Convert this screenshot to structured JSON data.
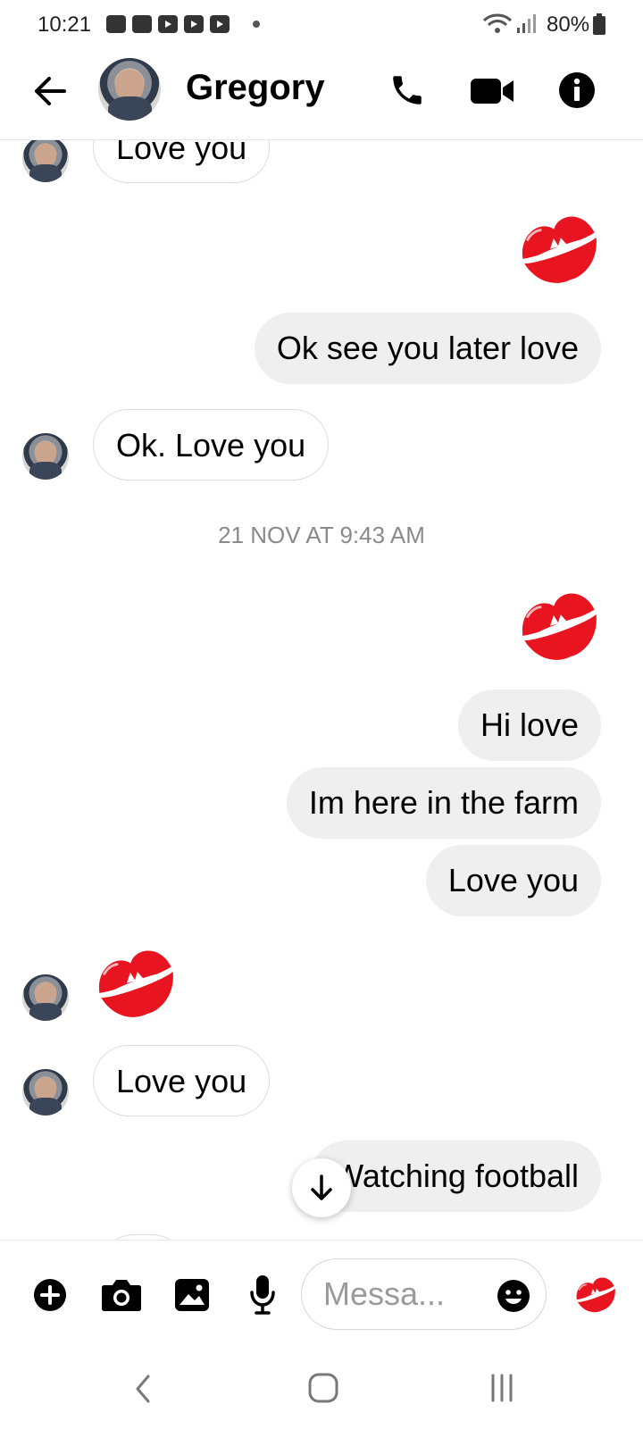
{
  "status_bar": {
    "time": "10:21",
    "battery": "80%",
    "notification_icons": [
      "shopping-bag-icon",
      "folder-icon",
      "youtube-icon",
      "youtube-icon",
      "youtube-icon"
    ]
  },
  "header": {
    "contact_name": "Gregory",
    "actions": [
      "phone-icon",
      "video-icon",
      "info-icon"
    ]
  },
  "messages": [
    {
      "from": "them",
      "text": "Love you"
    },
    {
      "from": "me",
      "emoji": "kiss-mark"
    },
    {
      "from": "me",
      "text": "Ok see you later love"
    },
    {
      "from": "them",
      "text": "Ok. Love you"
    },
    {
      "type": "timestamp",
      "text": "21 NOV AT 9:43 AM"
    },
    {
      "from": "me",
      "emoji": "kiss-mark"
    },
    {
      "from": "me",
      "text": "Hi love"
    },
    {
      "from": "me",
      "text": "Im here in the farm"
    },
    {
      "from": "me",
      "text": "Love you"
    },
    {
      "from": "them",
      "emoji": "kiss-mark"
    },
    {
      "from": "them",
      "text": "Love you"
    },
    {
      "from": "me",
      "text": "Watching football"
    }
  ],
  "composer": {
    "placeholder": "Messa...",
    "actions": [
      "plus-icon",
      "camera-icon",
      "gallery-icon",
      "microphone-icon"
    ],
    "quick_reaction": "kiss-mark"
  },
  "nav_bar": {
    "buttons": [
      "back-icon",
      "home-icon",
      "recents-icon"
    ]
  },
  "colors": {
    "kiss_red": "#e8141f",
    "bubble_out": "#efefef",
    "timestamp_gray": "#8a8a8a"
  }
}
